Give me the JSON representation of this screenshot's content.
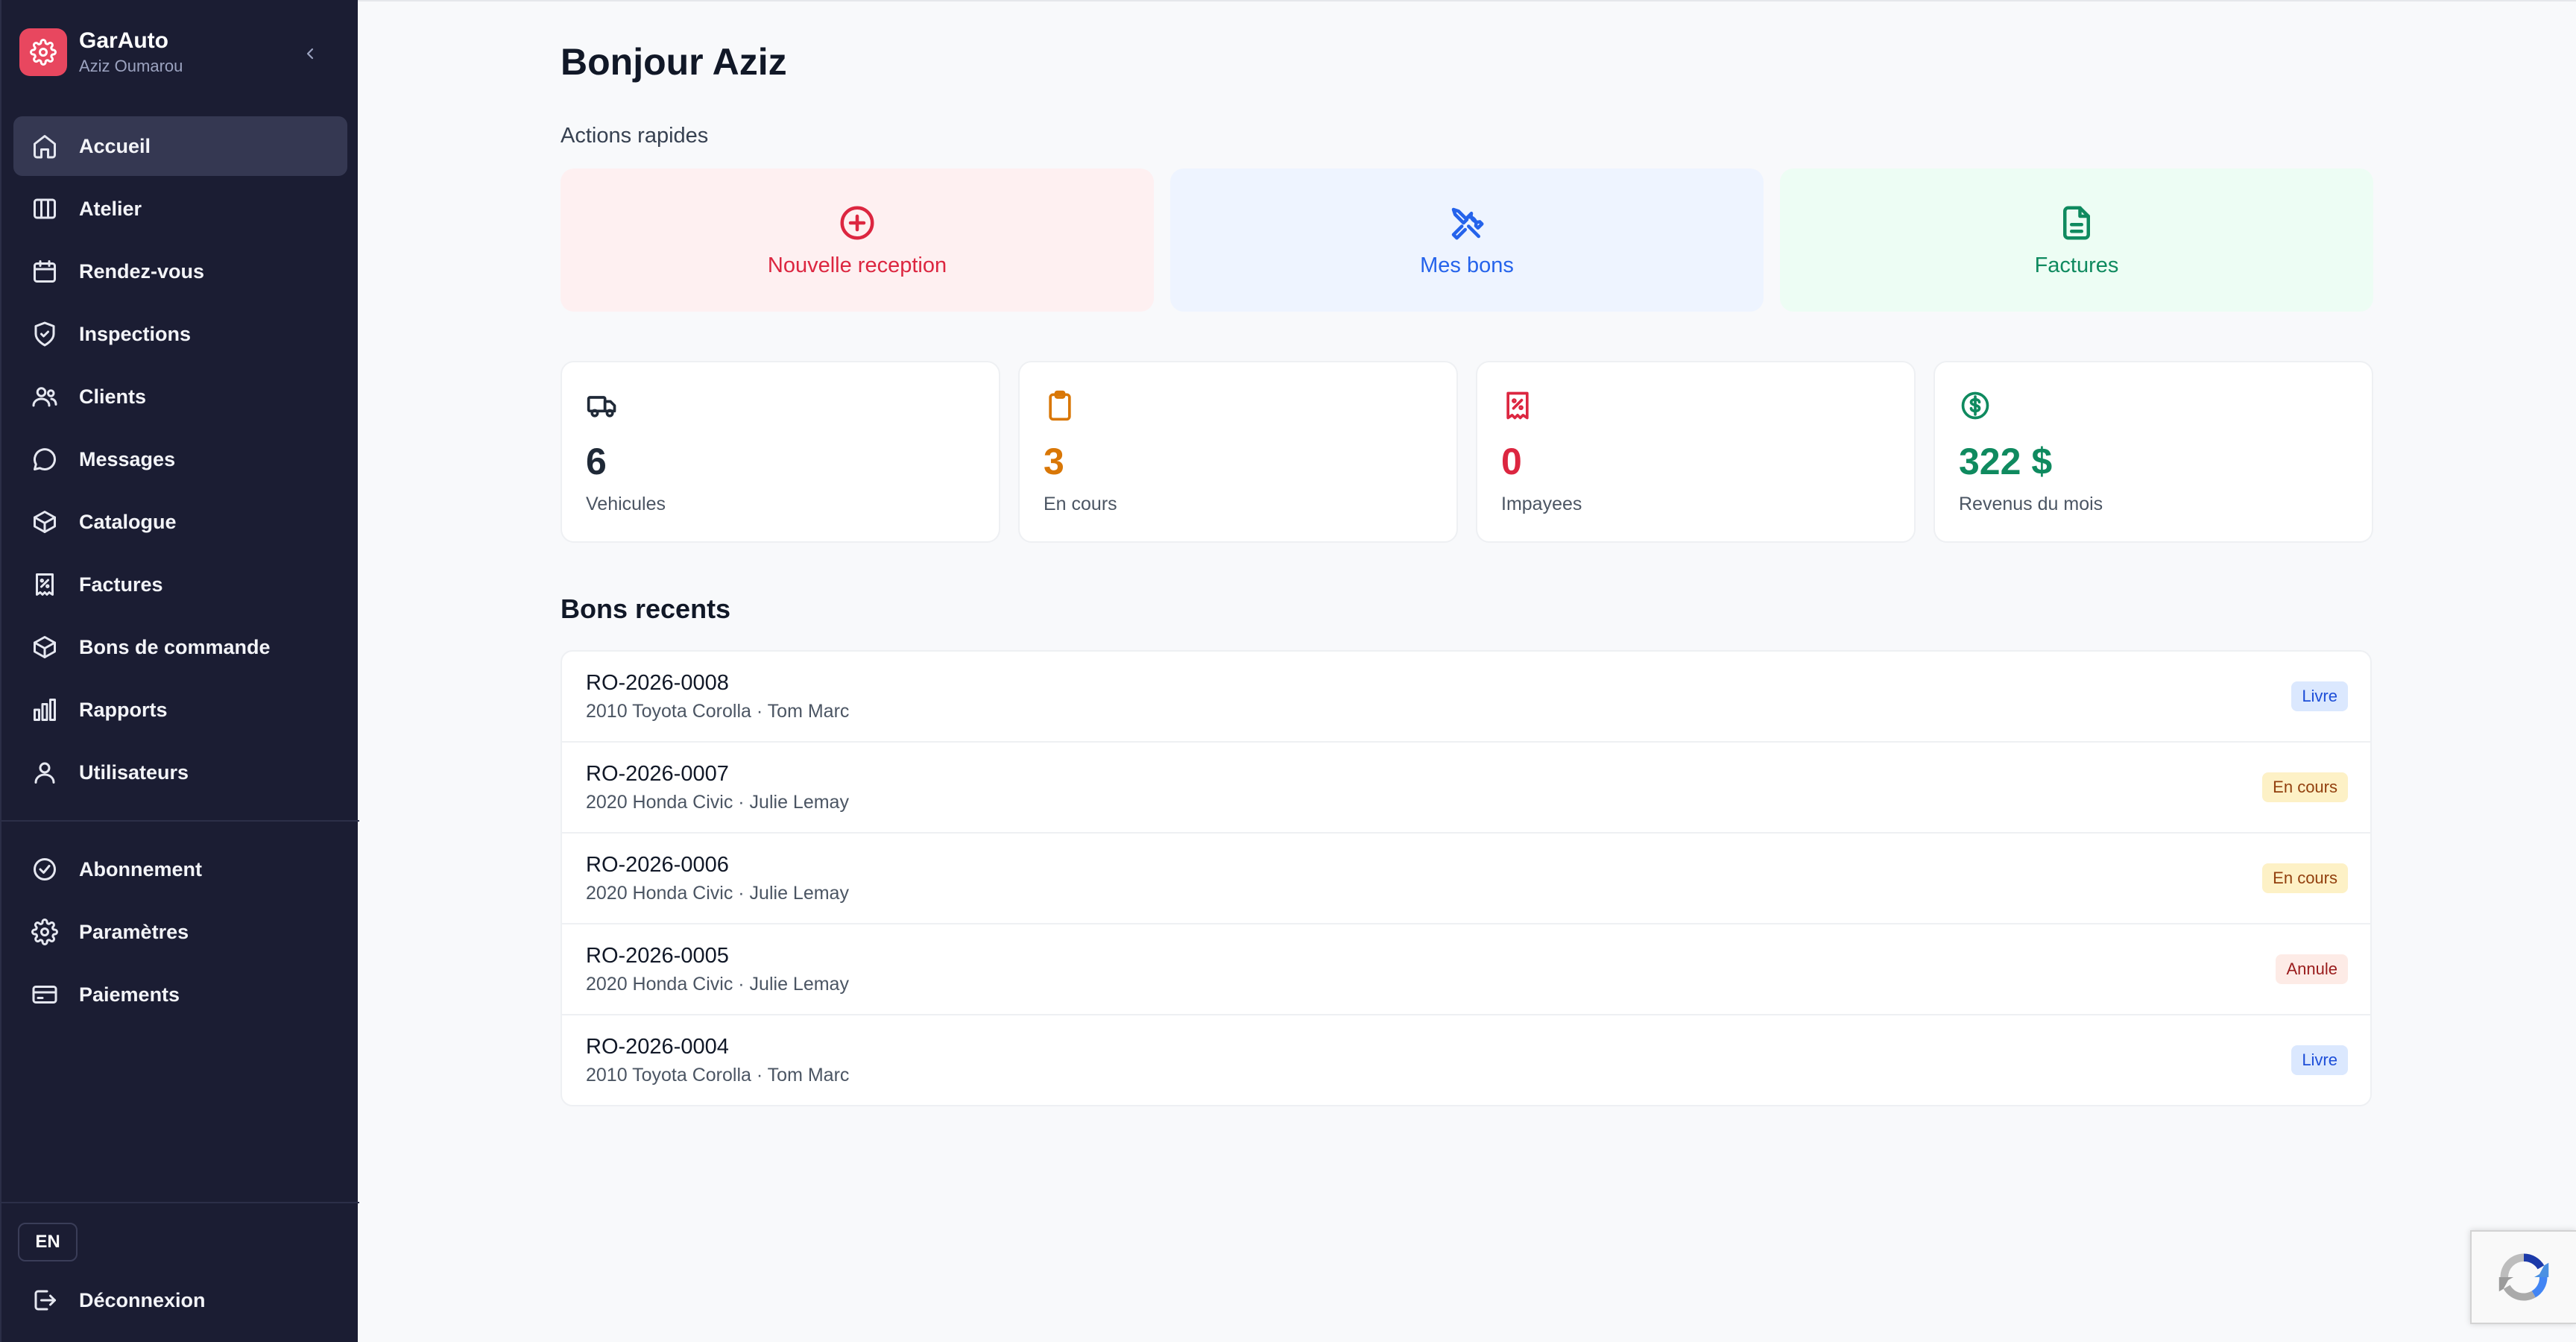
{
  "brand": {
    "name": "GarAuto",
    "user": "Aziz Oumarou"
  },
  "sidebar": {
    "items": [
      {
        "label": "Accueil",
        "icon": "home-icon",
        "active": true
      },
      {
        "label": "Atelier",
        "icon": "columns-icon"
      },
      {
        "label": "Rendez-vous",
        "icon": "calendar-icon"
      },
      {
        "label": "Inspections",
        "icon": "shield-check-icon"
      },
      {
        "label": "Clients",
        "icon": "users-icon"
      },
      {
        "label": "Messages",
        "icon": "chat-bubble-icon"
      },
      {
        "label": "Catalogue",
        "icon": "box-icon"
      },
      {
        "label": "Factures",
        "icon": "receipt-icon"
      },
      {
        "label": "Bons de commande",
        "icon": "box-icon"
      },
      {
        "label": "Rapports",
        "icon": "bar-chart-icon"
      },
      {
        "label": "Utilisateurs",
        "icon": "user-icon"
      }
    ],
    "secondary": [
      {
        "label": "Abonnement",
        "icon": "check-circle-icon"
      },
      {
        "label": "Paramètres",
        "icon": "gear-icon"
      },
      {
        "label": "Paiements",
        "icon": "credit-card-icon"
      }
    ],
    "language": "EN",
    "logout": "Déconnexion"
  },
  "main": {
    "greeting": "Bonjour Aziz",
    "quick_actions_label": "Actions rapides",
    "quick_actions": [
      {
        "label": "Nouvelle reception",
        "icon": "plus-circle-icon",
        "color": "#dc2640",
        "bg": "#fef0f1"
      },
      {
        "label": "Mes bons",
        "icon": "tools-icon",
        "color": "#2563eb",
        "bg": "#eef4ff"
      },
      {
        "label": "Factures",
        "icon": "file-icon",
        "color": "#0f8a5f",
        "bg": "#edfdf4"
      }
    ],
    "stats": [
      {
        "value": "6",
        "caption": "Vehicules",
        "icon": "truck-icon",
        "color": "#1f2937"
      },
      {
        "value": "3",
        "caption": "En cours",
        "icon": "clipboard-icon",
        "color": "#d97706"
      },
      {
        "value": "0",
        "caption": "Impayees",
        "icon": "receipt-icon",
        "color": "#dc2640"
      },
      {
        "value": "322 $",
        "caption": "Revenus du mois",
        "icon": "dollar-circle-icon",
        "color": "#0f8a5f"
      }
    ],
    "recent_title": "Bons recents",
    "recent": [
      {
        "number": "RO-2026-0008",
        "details": "2010 Toyota Corolla · Tom Marc",
        "status": "Livre",
        "status_color": "#1d4ed8",
        "status_bg": "#dbe8fe"
      },
      {
        "number": "RO-2026-0007",
        "details": "2020 Honda Civic · Julie Lemay",
        "status": "En cours",
        "status_color": "#92400e",
        "status_bg": "#fdf1c6"
      },
      {
        "number": "RO-2026-0006",
        "details": "2020 Honda Civic · Julie Lemay",
        "status": "En cours",
        "status_color": "#92400e",
        "status_bg": "#fdf1c6"
      },
      {
        "number": "RO-2026-0005",
        "details": "2020 Honda Civic · Julie Lemay",
        "status": "Annule",
        "status_color": "#991b1b",
        "status_bg": "#fdebe6"
      },
      {
        "number": "RO-2026-0004",
        "details": "2010 Toyota Corolla · Tom Marc",
        "status": "Livre",
        "status_color": "#1d4ed8",
        "status_bg": "#dbe8fe"
      }
    ]
  },
  "widgets": {
    "recaptcha_icon": "recaptcha-icon"
  }
}
